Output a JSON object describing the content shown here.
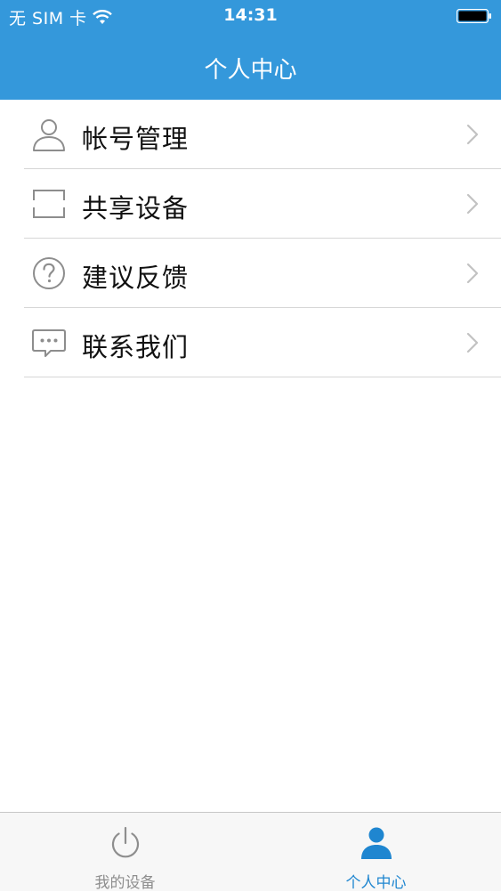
{
  "status_bar": {
    "carrier": "无 SIM 卡",
    "time": "14:31"
  },
  "header": {
    "title": "个人中心"
  },
  "menu": {
    "items": [
      {
        "label": "帐号管理",
        "icon": "user-icon"
      },
      {
        "label": "共享设备",
        "icon": "share-device-icon"
      },
      {
        "label": "建议反馈",
        "icon": "question-circle-icon"
      },
      {
        "label": "联系我们",
        "icon": "chat-bubble-icon"
      }
    ]
  },
  "tabbar": {
    "tabs": [
      {
        "label": "我的设备",
        "icon": "power-icon",
        "active": false
      },
      {
        "label": "个人中心",
        "icon": "person-icon",
        "active": true
      }
    ]
  },
  "colors": {
    "header_bg": "#3498db",
    "active_tab": "#1f86d0",
    "inactive_tab": "#8e8e8e"
  }
}
